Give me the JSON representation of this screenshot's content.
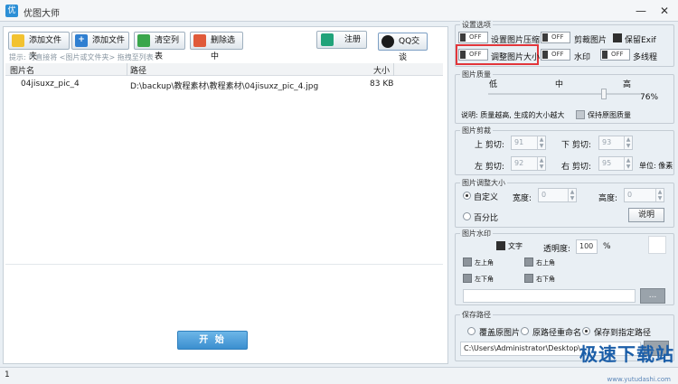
{
  "window": {
    "title": "优图大师",
    "minimize": "—",
    "close": "✕"
  },
  "toolbar": {
    "add_folder": "添加文件夹",
    "add_file": "添加文件",
    "clear_list": "清空列表",
    "delete_selected": "删除选中",
    "register": "注册",
    "qq": "QQ交谈"
  },
  "hint": "提示: 可直接将 <图片或文件夹> 拖拽至列表",
  "list": {
    "headers": {
      "name": "图片名",
      "path": "路径",
      "size": "大小"
    },
    "rows": [
      {
        "name": "04jisuxz_pic_4",
        "path": "D:\\backup\\教程素材\\教程素材\\04jisuxz_pic_4.jpg",
        "size": "83 KB"
      }
    ]
  },
  "start": "开 始",
  "status": "1",
  "settings": {
    "caption": "设置选项",
    "off": "OFF",
    "compress": "设置图片压缩",
    "crop": "剪裁图片",
    "keep_exif": "保留Exif",
    "resize": "调整图片大小",
    "watermark": "水印",
    "multithread": "多线程"
  },
  "quality": {
    "caption": "图片质量",
    "low": "低",
    "mid": "中",
    "high": "高",
    "percent": "76%",
    "value": 0.76,
    "note": "说明: 质量越高, 生成的大小越大",
    "keep_original": "保持原图质量"
  },
  "crop": {
    "caption": "图片剪裁",
    "top_label": "上 剪切:",
    "top": "91",
    "bottom_label": "下 剪切:",
    "bottom": "93",
    "left_label": "左 剪切:",
    "left": "92",
    "right_label": "右 剪切:",
    "right": "95",
    "unit": "单位: 像素"
  },
  "resize": {
    "caption": "图片调整大小",
    "custom": "自定义",
    "width_label": "宽度:",
    "width": "0",
    "height_label": "高度:",
    "height": "0",
    "percent": "百分比",
    "explain": "说明"
  },
  "wm": {
    "caption": "图片水印",
    "text": "文字",
    "opacity_label": "透明度:",
    "opacity": "100",
    "opacity_unit": "%",
    "items": [
      "左上角",
      "右上角",
      "左下角",
      "右下角"
    ],
    "browse": "..."
  },
  "save": {
    "caption": "保存路径",
    "overwrite": "覆盖原图片",
    "rename": "原路径重命名",
    "to_path": "保存到指定路径",
    "path": "C:\\Users\\Administrator\\Desktop\\",
    "browse": "..."
  },
  "watermark_overlay": {
    "brand": "极速下载站",
    "url": "www.yutudashi.com"
  }
}
